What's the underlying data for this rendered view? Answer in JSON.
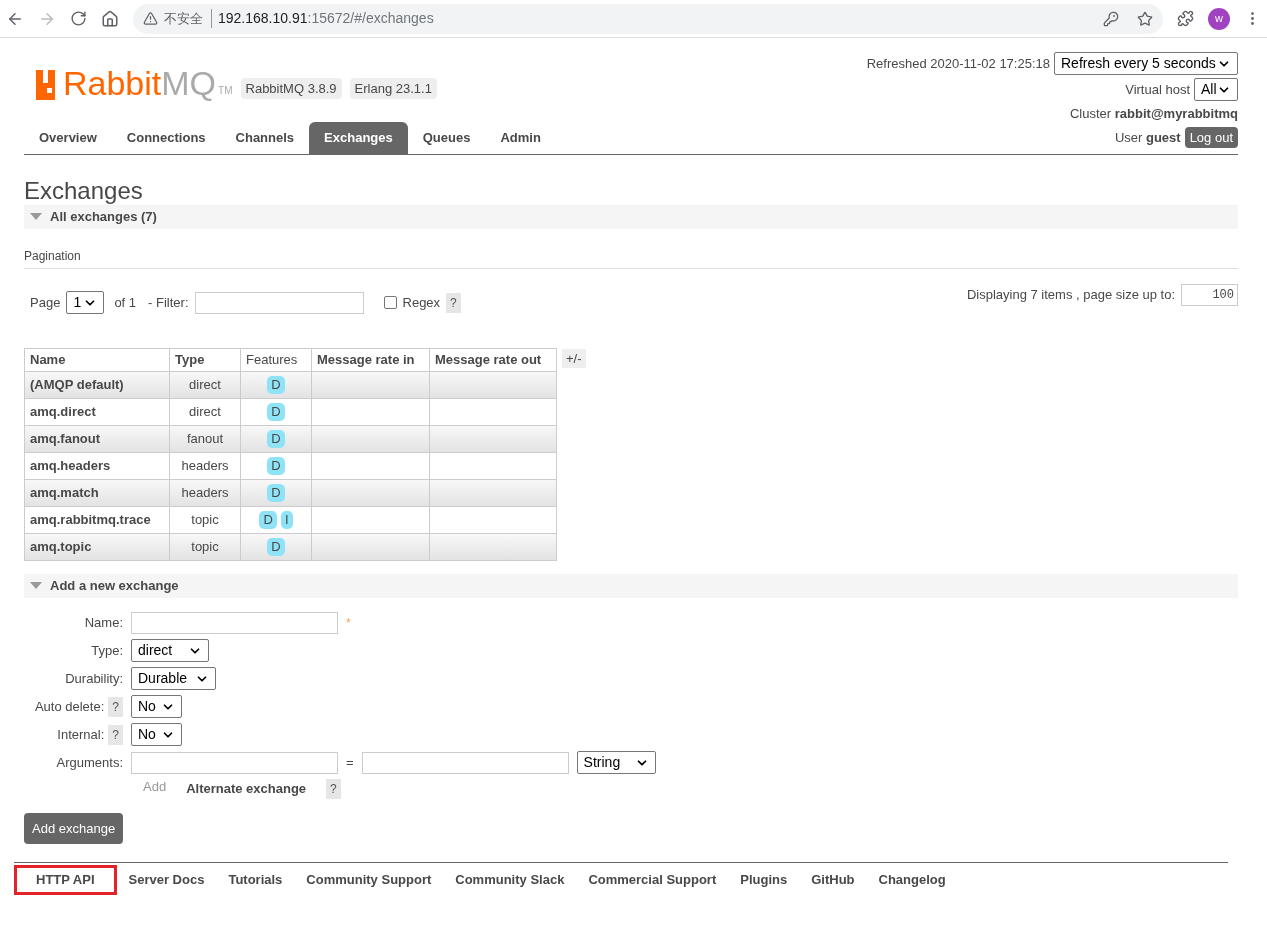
{
  "browser": {
    "security_label": "不安全",
    "url_host": "192.168.10.91",
    "url_rest": ":15672/#/exchanges",
    "avatar": "w"
  },
  "logo": {
    "brand": "Rabbit",
    "suffix": "MQ",
    "tm": "TM"
  },
  "header": {
    "versions": [
      "RabbitMQ 3.8.9",
      "Erlang 23.1.1"
    ],
    "refreshed": "Refreshed 2020-11-02 17:25:18",
    "refresh_select": "Refresh every 5 seconds",
    "vhost_label": "Virtual host",
    "vhost_select": "All",
    "cluster_label": "Cluster",
    "cluster": "rabbit@myrabbitmq",
    "user_label": "User",
    "user": "guest",
    "logout": "Log out"
  },
  "tabs": [
    {
      "label": "Overview",
      "selected": false
    },
    {
      "label": "Connections",
      "selected": false
    },
    {
      "label": "Channels",
      "selected": false
    },
    {
      "label": "Exchanges",
      "selected": true
    },
    {
      "label": "Queues",
      "selected": false
    },
    {
      "label": "Admin",
      "selected": false
    }
  ],
  "page_title": "Exchanges",
  "section": {
    "title": "All exchanges (7)",
    "expanded": true
  },
  "pagination": {
    "heading": "Pagination",
    "page_label": "Page",
    "page_select": "1",
    "of": "of 1",
    "filter_label": "- Filter:",
    "regex_label": "Regex",
    "regex_checked": false,
    "help": "?",
    "displaying": "Displaying 7 items , page size up to:",
    "page_size": "100"
  },
  "table": {
    "columns": [
      "Name",
      "Type",
      "Features",
      "Message rate in",
      "Message rate out"
    ],
    "toggle": "+/-",
    "rows": [
      {
        "name": "(AMQP default)",
        "type": "direct",
        "features": [
          "D"
        ]
      },
      {
        "name": "amq.direct",
        "type": "direct",
        "features": [
          "D"
        ]
      },
      {
        "name": "amq.fanout",
        "type": "fanout",
        "features": [
          "D"
        ]
      },
      {
        "name": "amq.headers",
        "type": "headers",
        "features": [
          "D"
        ]
      },
      {
        "name": "amq.match",
        "type": "headers",
        "features": [
          "D"
        ]
      },
      {
        "name": "amq.rabbitmq.trace",
        "type": "topic",
        "features": [
          "D",
          "I"
        ]
      },
      {
        "name": "amq.topic",
        "type": "topic",
        "features": [
          "D"
        ]
      }
    ]
  },
  "add_section": {
    "title": "Add a new exchange",
    "expanded": true,
    "fields": [
      {
        "label": "Name:",
        "kind": "text",
        "required_mark": "*"
      },
      {
        "label": "Type:",
        "kind": "select",
        "value": "direct"
      },
      {
        "label": "Durability:",
        "kind": "select",
        "value": "Durable"
      },
      {
        "label": "Auto delete:",
        "kind": "select",
        "value": "No",
        "help": "?"
      },
      {
        "label": "Internal:",
        "kind": "select",
        "value": "No",
        "help": "?"
      },
      {
        "label": "Arguments:",
        "kind": "arguments",
        "equals": "=",
        "value": "String"
      }
    ],
    "add_link": "Add",
    "alternate": "Alternate exchange",
    "alternate_help": "?",
    "submit": "Add exchange"
  },
  "footer": [
    {
      "label": "HTTP API",
      "highlighted": true
    },
    {
      "label": "Server Docs",
      "highlighted": false
    },
    {
      "label": "Tutorials",
      "highlighted": false
    },
    {
      "label": "Community Support",
      "highlighted": false
    },
    {
      "label": "Community Slack",
      "highlighted": false
    },
    {
      "label": "Commercial Support",
      "highlighted": false
    },
    {
      "label": "Plugins",
      "highlighted": false
    },
    {
      "label": "GitHub",
      "highlighted": false
    },
    {
      "label": "Changelog",
      "highlighted": false
    }
  ]
}
